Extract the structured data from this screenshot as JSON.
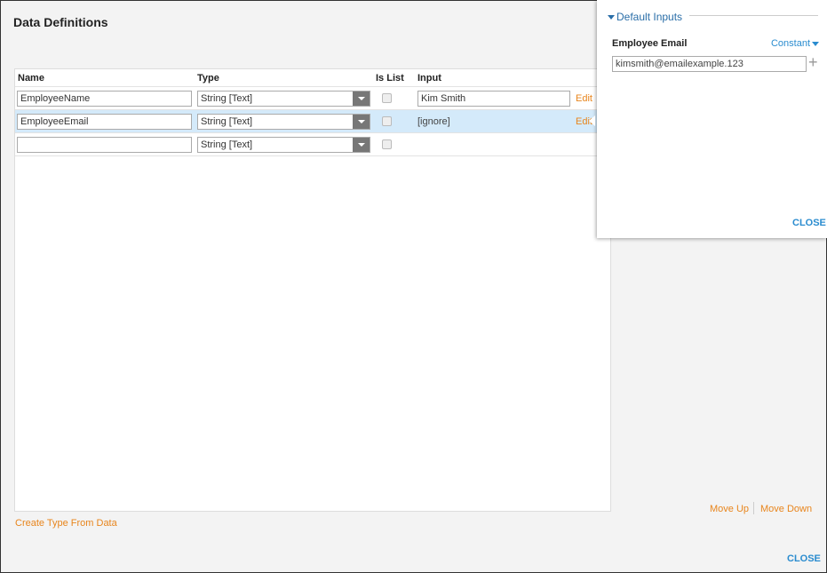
{
  "title": "Data Definitions",
  "table": {
    "headers": {
      "name": "Name",
      "type": "Type",
      "is_list": "Is List",
      "input": "Input"
    },
    "rows": [
      {
        "name": "EmployeeName",
        "type": "String [Text]",
        "is_list": false,
        "input": "Kim Smith",
        "input_kind": "textbox",
        "action": "Edit",
        "selected": false
      },
      {
        "name": "EmployeeEmail",
        "type": "String [Text]",
        "is_list": false,
        "input": "[ignore]",
        "input_kind": "text",
        "action": "Edit",
        "selected": true
      },
      {
        "name": "",
        "type": "String [Text]",
        "is_list": false
      }
    ]
  },
  "panel": {
    "section": "Default Inputs",
    "field_label": "Employee Email",
    "mode": "Constant",
    "value": "kimsmith@emailexample.123",
    "add_icon": "plus-icon",
    "close": "CLOSE"
  },
  "footer": {
    "create_type": "Create Type From Data",
    "move_up": "Move Up",
    "move_down": "Move Down",
    "close": "CLOSE"
  },
  "colors": {
    "accent_orange": "#e8851c",
    "accent_blue": "#2a8ccf",
    "selected_row": "#d4eafa"
  }
}
